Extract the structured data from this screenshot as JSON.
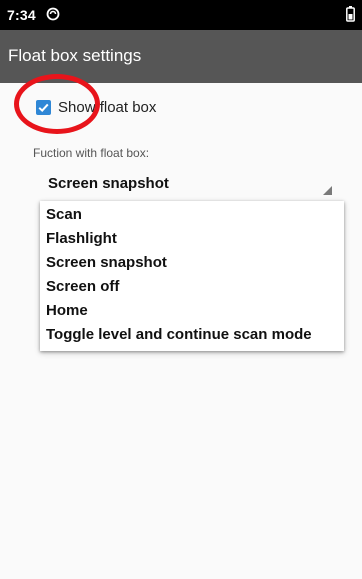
{
  "status_bar": {
    "time": "7:34",
    "notification_icon": "sync-icon",
    "battery_icon": "battery-icon"
  },
  "app_bar": {
    "title": "Float box settings"
  },
  "settings": {
    "show_float_box": {
      "label": "Show float box",
      "checked": true
    },
    "function_label": "Fuction with float box:",
    "spinner_value": "Screen snapshot",
    "dropdown_options": [
      "Scan",
      "Flashlight",
      "Screen snapshot",
      "Screen off",
      "Home",
      "Toggle level and continue scan mode"
    ]
  },
  "colors": {
    "app_bar": "#565656",
    "checkbox_accent": "#2f87d6",
    "annotation_circle": "#e8141b"
  }
}
